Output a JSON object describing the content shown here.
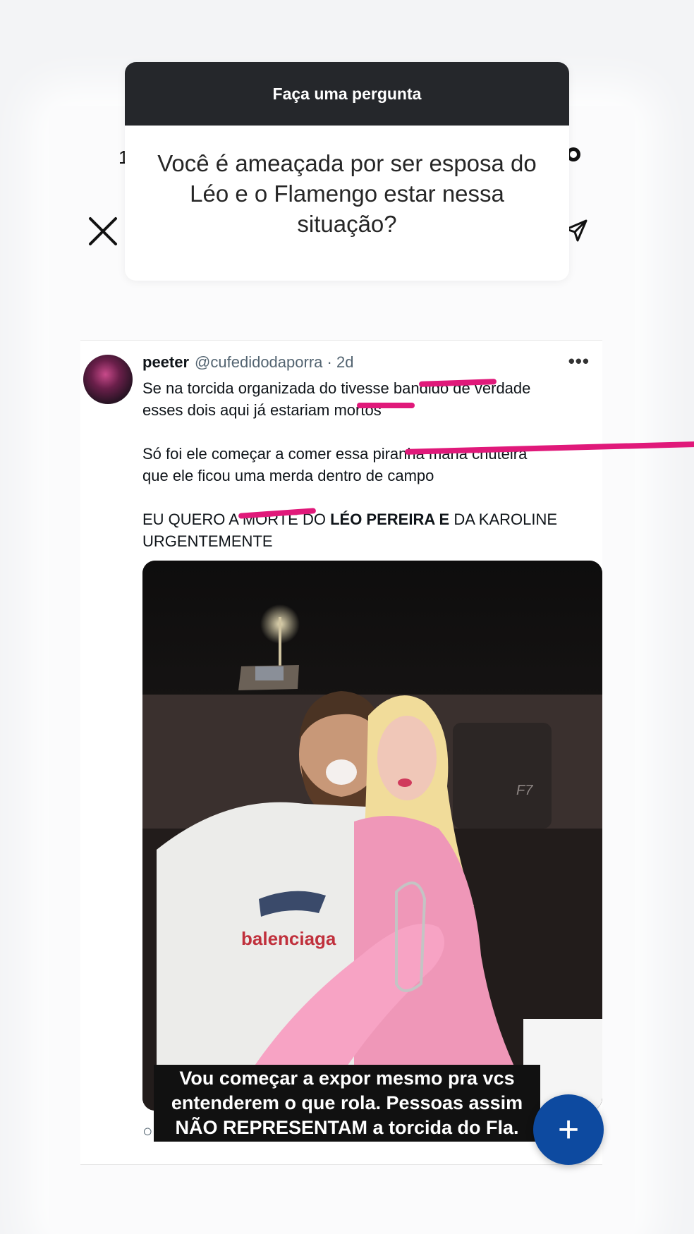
{
  "question": {
    "header": "Faça uma pergunta",
    "text": "Você é ameaçada por ser esposa do Léo e o Flamengo estar nessa situação?"
  },
  "story": {
    "behind_digit": "1",
    "close_icon": "close-icon",
    "send_icon": "send-icon"
  },
  "tweet": {
    "name": "peeter",
    "handle": "@cufedidodaporra",
    "time": "· 2d",
    "more": "•••",
    "line1": "Se na torcida organizada do tivesse bandido de verdade",
    "line2": "esses dois aqui já estariam mortos",
    "line3": "Só foi ele começar a comer essa piranha maria chuteira",
    "line4": "que ele ficou uma merda dentro de campo",
    "line5_a": "EU QUERO A MORTE DO ",
    "line5_b": "LÉO PEREIRA E",
    "line5_c": " DA KAROLINE",
    "line6": "URGENTEMENTE",
    "photo_text_balenciaga": "balenciaga",
    "photo_text_seat": "F7"
  },
  "caption": {
    "line1": "Vou começar a expor mesmo pra vcs",
    "line2": "entenderem o que rola. Pessoas assim",
    "line3": "NÃO REPRESENTAM a torcida do Fla."
  },
  "fab": {
    "label": "+"
  },
  "colors": {
    "scribble": "#e0197a",
    "fab": "#0d4aa0",
    "header": "#25272b"
  }
}
